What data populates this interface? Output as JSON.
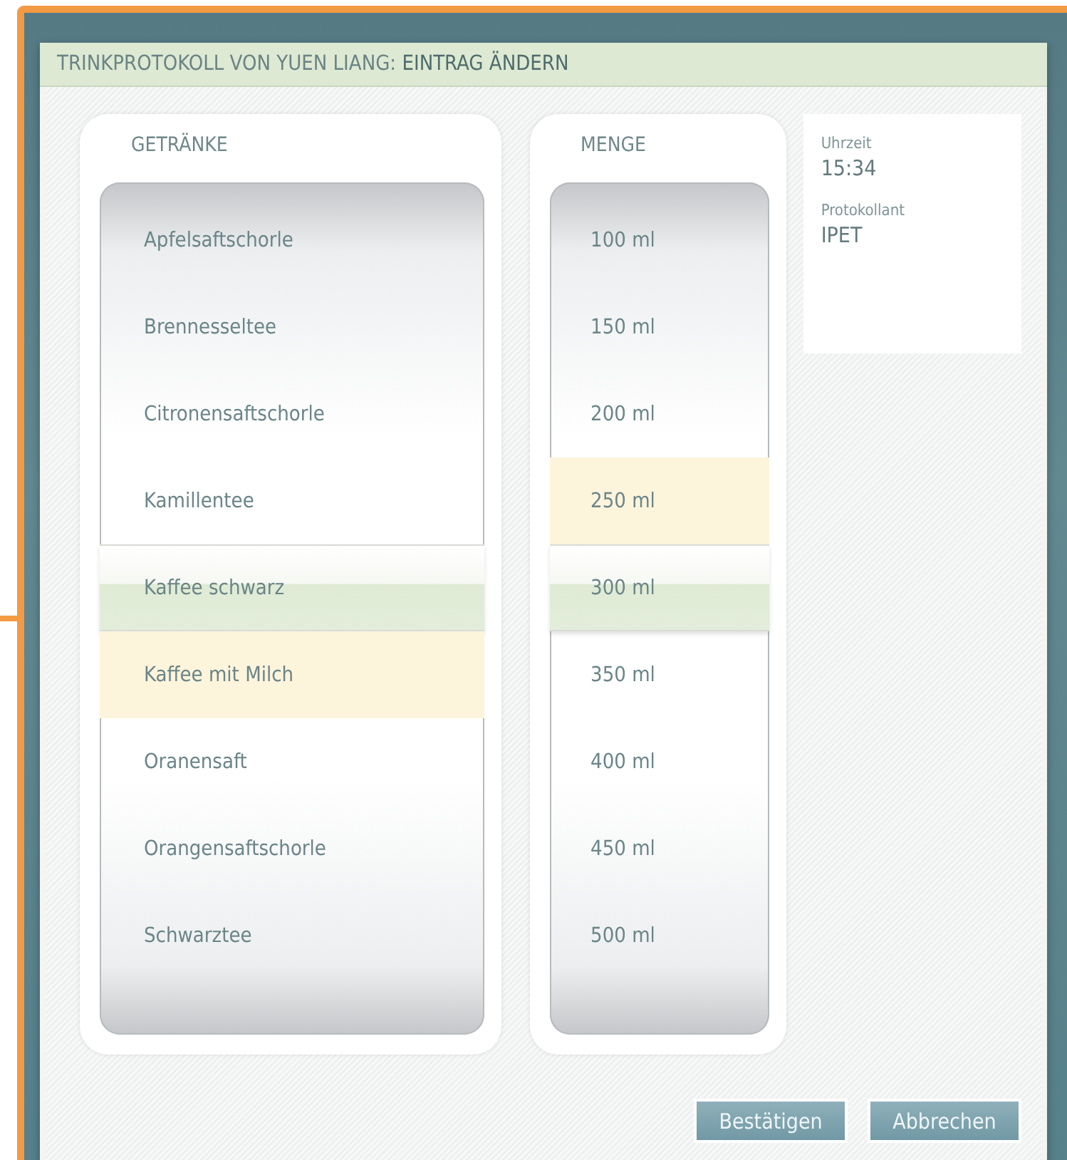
{
  "title": "TRINKPROTOKOLL VON YUEN LIANG: **EINTRAG ÄNDERN**",
  "pickers": [
    {
      "header": "GETRÄNKE",
      "items": [
        {
          "label": "Apfelsaftschorle",
          "selected": false,
          "highlighted": false
        },
        {
          "label": "Brennesseltee",
          "selected": false,
          "highlighted": false
        },
        {
          "label": "Citronensaftschorle",
          "selected": false,
          "highlighted": false
        },
        {
          "label": "Kamillentee",
          "selected": false,
          "highlighted": false
        },
        {
          "label": "Kaffee schwarz",
          "selected": true,
          "highlighted": false
        },
        {
          "label": "Kaffee mit Milch",
          "selected": false,
          "highlighted": true
        },
        {
          "label": "Oranensaft",
          "selected": false,
          "highlighted": false
        },
        {
          "label": "Orangensaftschorle",
          "selected": false,
          "highlighted": false
        },
        {
          "label": "Schwarztee",
          "selected": false,
          "highlighted": false
        }
      ]
    },
    {
      "header": "MENGE",
      "items": [
        {
          "label": "100 ml",
          "selected": false,
          "highlighted": false
        },
        {
          "label": "150 ml",
          "selected": false,
          "highlighted": false
        },
        {
          "label": "200 ml",
          "selected": false,
          "highlighted": false
        },
        {
          "label": "250 ml",
          "selected": false,
          "highlighted": true
        },
        {
          "label": "300 ml",
          "selected": true,
          "highlighted": false
        },
        {
          "label": "350 ml",
          "selected": false,
          "highlighted": false
        },
        {
          "label": "400 ml",
          "selected": false,
          "highlighted": false
        },
        {
          "label": "450 ml",
          "selected": false,
          "highlighted": false
        },
        {
          "label": "500 ml",
          "selected": false,
          "highlighted": false
        }
      ]
    }
  ],
  "info": [
    {
      "label": "Uhrzeit",
      "value": "15:34"
    },
    {
      "label": "Protokollant",
      "value": "IPET"
    }
  ],
  "buttons": [
    "Bestätigen",
    "Abbrechen"
  ]
}
